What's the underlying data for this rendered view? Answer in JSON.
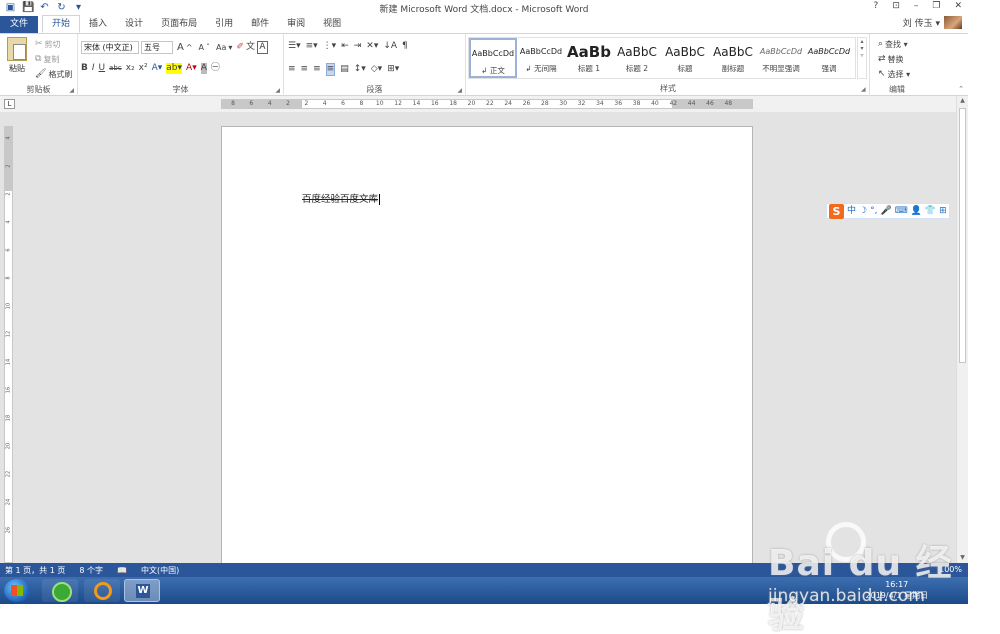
{
  "window": {
    "title": "新建 Microsoft Word 文档.docx - Microsoft Word",
    "help": "?",
    "minimize": "–",
    "restore": "❐",
    "close": "✕",
    "ribbon_display": "⊡"
  },
  "user": {
    "name": "刘 传玉 ▾"
  },
  "tabs": [
    "文件",
    "开始",
    "插入",
    "设计",
    "页面布局",
    "引用",
    "邮件",
    "审阅",
    "视图"
  ],
  "clipboard": {
    "label": "剪贴板",
    "paste": "粘贴",
    "cut": "剪切",
    "copy": "复制",
    "format_painter": "格式刷"
  },
  "font": {
    "label": "字体",
    "name": "宋体 (中文正)",
    "size": "五号",
    "grow": "A",
    "shrink": "A",
    "case": "Aa",
    "bold": "B",
    "italic": "I",
    "underline": "U",
    "strike": "abc",
    "subscript": "x₂",
    "superscript": "x²"
  },
  "paragraph": {
    "label": "段落"
  },
  "styles": {
    "label": "样式",
    "items": [
      {
        "sample": "AaBbCcDd",
        "name": "↲ 正文"
      },
      {
        "sample": "AaBbCcDd",
        "name": "↲ 无间隔"
      },
      {
        "sample": "AaBb",
        "name": "标题 1"
      },
      {
        "sample": "AaBbC",
        "name": "标题 2"
      },
      {
        "sample": "AaBbC",
        "name": "标题"
      },
      {
        "sample": "AaBbC",
        "name": "副标题"
      },
      {
        "sample": "AaBbCcDd",
        "name": "不明显强调"
      },
      {
        "sample": "AaBbCcDd",
        "name": "强调"
      }
    ]
  },
  "editing": {
    "label": "编辑",
    "find": "查找 ▾",
    "replace": "替换",
    "select": "选择 ▾"
  },
  "ruler": {
    "corner": "L",
    "h_ticks": [
      "8",
      "6",
      "4",
      "2",
      "2",
      "4",
      "6",
      "8",
      "10",
      "12",
      "14",
      "16",
      "18",
      "20",
      "22",
      "24",
      "26",
      "28",
      "30",
      "32",
      "34",
      "36",
      "38",
      "40",
      "42",
      "44",
      "46",
      "48"
    ],
    "v_ticks": [
      "4",
      "2",
      "2",
      "4",
      "6",
      "8",
      "10",
      "12",
      "14",
      "16",
      "18",
      "20",
      "22",
      "24",
      "26"
    ]
  },
  "document": {
    "text": "百度经验百度文库"
  },
  "ime": {
    "mode": "中"
  },
  "status": {
    "page": "第 1 页，共 1 页",
    "words": "8 个字",
    "language": "中文(中国)",
    "zoom": "100%"
  },
  "taskbar": {
    "time": "16:17",
    "date": "2019/4/1 星期日"
  },
  "watermark": {
    "brand": "Bai du 经验",
    "url": "jingyan.baidu.com"
  }
}
